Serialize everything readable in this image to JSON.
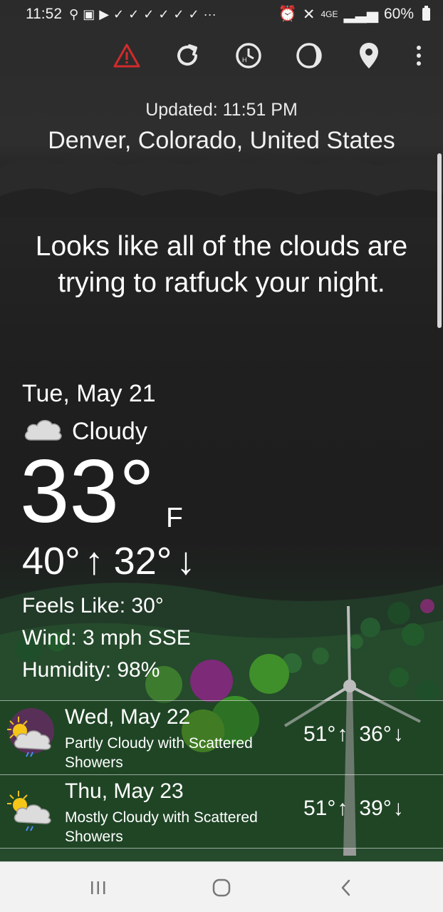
{
  "status_bar": {
    "time": "11:52",
    "network": "4GE",
    "battery": "60%"
  },
  "toolbar": {
    "icons": [
      "alert-icon",
      "refresh-icon",
      "history-icon",
      "moon-phase-icon",
      "location-pin-icon",
      "more-icon"
    ]
  },
  "header": {
    "updated": "Updated: 11:51 PM",
    "location": "Denver, Colorado, United States"
  },
  "quip": "Looks like all of the clouds are trying to ratfuck your night.",
  "current": {
    "date": "Tue, May 21",
    "condition": "Cloudy",
    "temp": "33°",
    "unit": "F",
    "high": "40°",
    "low": "32°",
    "feels_like": "Feels Like: 30°",
    "wind": "Wind: 3 mph SSE",
    "humidity": "Humidity: 98%"
  },
  "forecast": [
    {
      "date": "Wed, May 22",
      "desc": "Partly Cloudy with Scattered Showers",
      "high": "51°",
      "low": "36°"
    },
    {
      "date": "Thu, May 23",
      "desc": "Mostly Cloudy with Scattered Showers",
      "high": "51°",
      "low": "39°"
    }
  ],
  "colors": {
    "alert": "#d12b2b",
    "navbar": "#f2f2f2"
  }
}
